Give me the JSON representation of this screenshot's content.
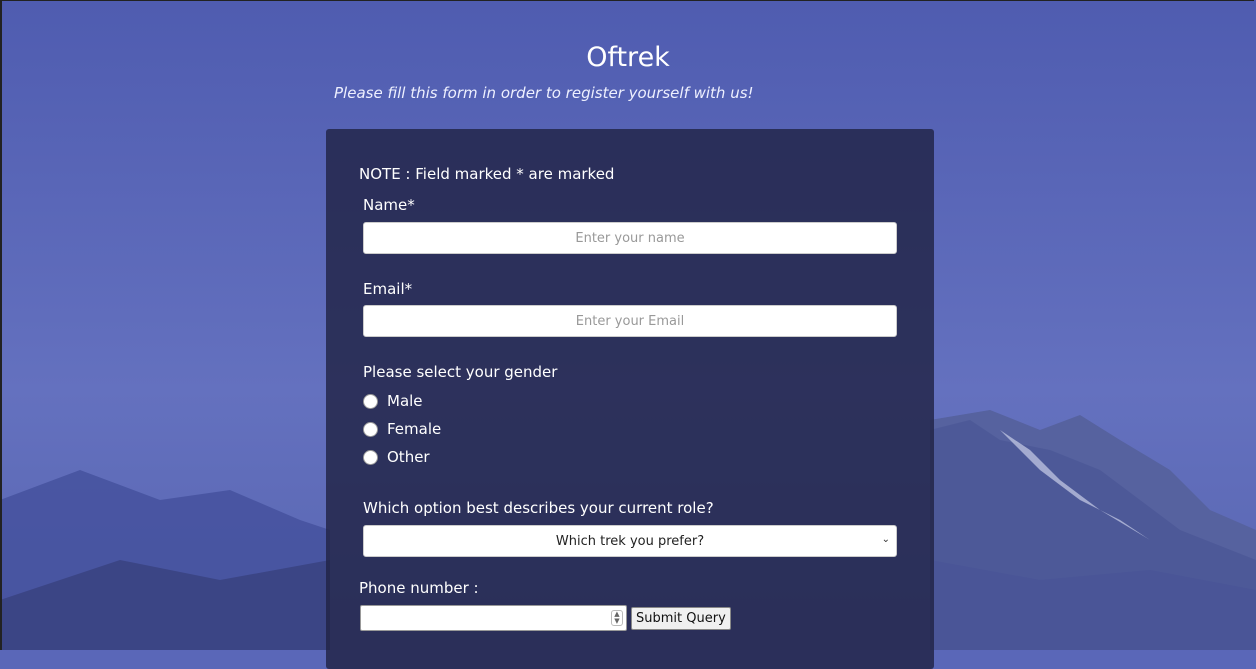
{
  "header": {
    "title": "Oftrek",
    "subtitle": "Please fill this form in order to register yourself with us!"
  },
  "form": {
    "note": "NOTE : Field marked * are marked",
    "name_label": "Name*",
    "name_placeholder": "Enter your name",
    "email_label": "Email*",
    "email_placeholder": "Enter your Email",
    "gender_label": "Please select your gender",
    "gender_options": [
      "Male",
      "Female",
      "Other"
    ],
    "role_label": "Which option best describes your current role?",
    "role_select_value": "Which trek you prefer?",
    "phone_label": "Phone number :",
    "submit_label": "Submit Query"
  },
  "colors": {
    "background": "#5a67b8",
    "card": "#212346"
  }
}
